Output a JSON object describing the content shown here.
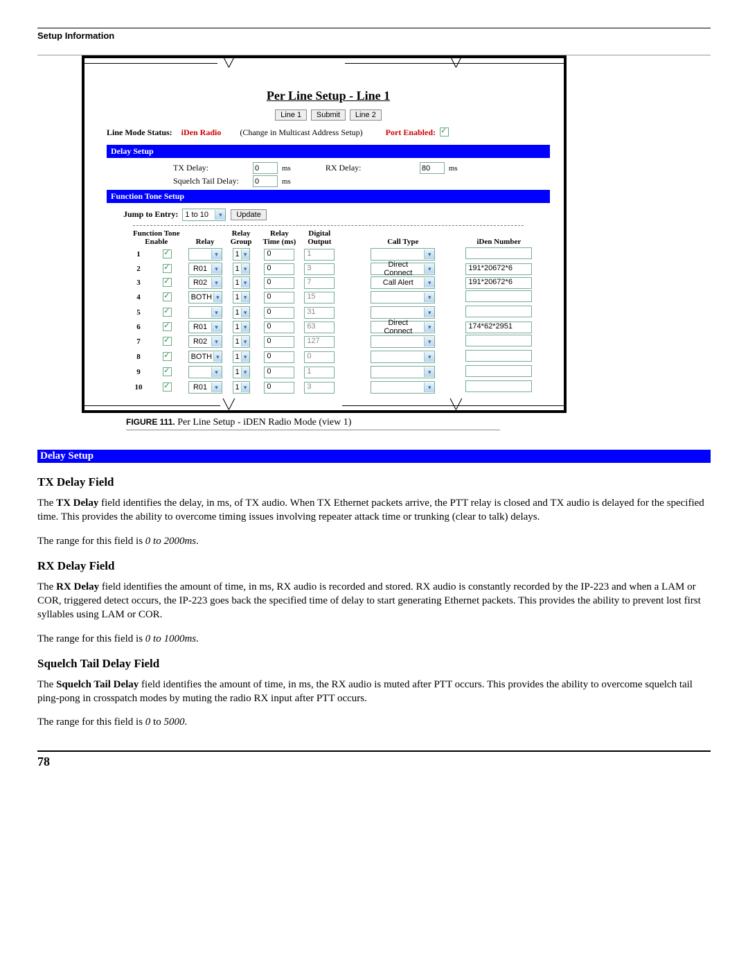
{
  "header": {
    "section": "Setup Information"
  },
  "figure": {
    "title": "Per Line Setup - Line 1",
    "buttons": {
      "line1": "Line 1",
      "submit": "Submit",
      "line2": "Line 2"
    },
    "status": {
      "label": "Line Mode Status:",
      "value": "iDen Radio",
      "note": "(Change in Multicast Address Setup)",
      "port_label": "Port Enabled:"
    },
    "bands": {
      "delay": "Delay Setup",
      "ftone": "Function Tone Setup"
    },
    "delay": {
      "tx_label": "TX Delay:",
      "tx_val": "0",
      "sq_label": "Squelch Tail Delay:",
      "sq_val": "0",
      "rx_label": "RX Delay:",
      "rx_val": "80",
      "unit": "ms"
    },
    "jump": {
      "label": "Jump to Entry:",
      "value": "1 to 10",
      "update": "Update"
    },
    "headers": {
      "fte1": "Function Tone",
      "fte2": "Enable",
      "relay": "Relay",
      "rgrp1": "Relay",
      "rgrp2": "Group",
      "rtime1": "Relay",
      "rtime2": "Time (ms)",
      "dout1": "Digital",
      "dout2": "Output",
      "ctype": "Call Type",
      "iden": "iDen Number"
    },
    "rows": [
      {
        "n": "1",
        "relay": "",
        "grp": "1",
        "time": "0",
        "dout": "1",
        "ctype": "",
        "iden": ""
      },
      {
        "n": "2",
        "relay": "R01",
        "grp": "1",
        "time": "0",
        "dout": "3",
        "ctype": "Direct Connect",
        "iden": "191*20672*6"
      },
      {
        "n": "3",
        "relay": "R02",
        "grp": "1",
        "time": "0",
        "dout": "7",
        "ctype": "Call Alert",
        "iden": "191*20672*6"
      },
      {
        "n": "4",
        "relay": "BOTH",
        "grp": "1",
        "time": "0",
        "dout": "15",
        "ctype": "",
        "iden": ""
      },
      {
        "n": "5",
        "relay": "",
        "grp": "1",
        "time": "0",
        "dout": "31",
        "ctype": "",
        "iden": ""
      },
      {
        "n": "6",
        "relay": "R01",
        "grp": "1",
        "time": "0",
        "dout": "63",
        "ctype": "Direct Connect",
        "iden": "174*62*2951"
      },
      {
        "n": "7",
        "relay": "R02",
        "grp": "1",
        "time": "0",
        "dout": "127",
        "ctype": "",
        "iden": ""
      },
      {
        "n": "8",
        "relay": "BOTH",
        "grp": "1",
        "time": "0",
        "dout": "0",
        "ctype": "",
        "iden": ""
      },
      {
        "n": "9",
        "relay": "",
        "grp": "1",
        "time": "0",
        "dout": "1",
        "ctype": "",
        "iden": ""
      },
      {
        "n": "10",
        "relay": "R01",
        "grp": "1",
        "time": "0",
        "dout": "3",
        "ctype": "",
        "iden": ""
      }
    ],
    "caption_label": "FIGURE 111.",
    "caption_text": " Per Line Setup - iDEN Radio Mode (view 1)"
  },
  "doc": {
    "band": "Delay Setup",
    "tx": {
      "h": "TX Delay Field",
      "p1a": "The ",
      "p1b": "TX Delay",
      "p1c": " field identifies the delay, in ms, of TX audio. When TX Ethernet packets arrive, the PTT relay is closed and TX audio is delayed for the specified time. This provides the ability to overcome timing issues involving repeater attack time or trunking (clear to talk) delays.",
      "p2a": "The range for this field is ",
      "p2b": "0 to 2000ms",
      "p2c": "."
    },
    "rx": {
      "h": "RX Delay Field",
      "p1a": "The ",
      "p1b": "RX Delay",
      "p1c": " field identifies the amount of time, in ms, RX audio is recorded and stored. RX audio is constantly recorded by the IP-223 and when a LAM or COR, triggered detect occurs, the IP-223 goes back the specified time of delay to start generating Ethernet packets. This provides the ability to prevent lost first syllables using LAM or COR.",
      "p2a": "The range for this field is ",
      "p2b": "0 to 1000ms",
      "p2c": "."
    },
    "sq": {
      "h": "Squelch Tail Delay Field",
      "p1a": "The ",
      "p1b": "Squelch Tail Delay",
      "p1c": " field identifies the amount of time, in ms, the RX audio is muted after PTT occurs. This provides the ability to overcome squelch tail ping-pong in crosspatch modes by muting the radio RX input after PTT occurs.",
      "p2a": "The range for this field is ",
      "p2b": "0",
      "p2c": " to ",
      "p2d": "5000",
      "p2e": "."
    }
  },
  "page": "78"
}
